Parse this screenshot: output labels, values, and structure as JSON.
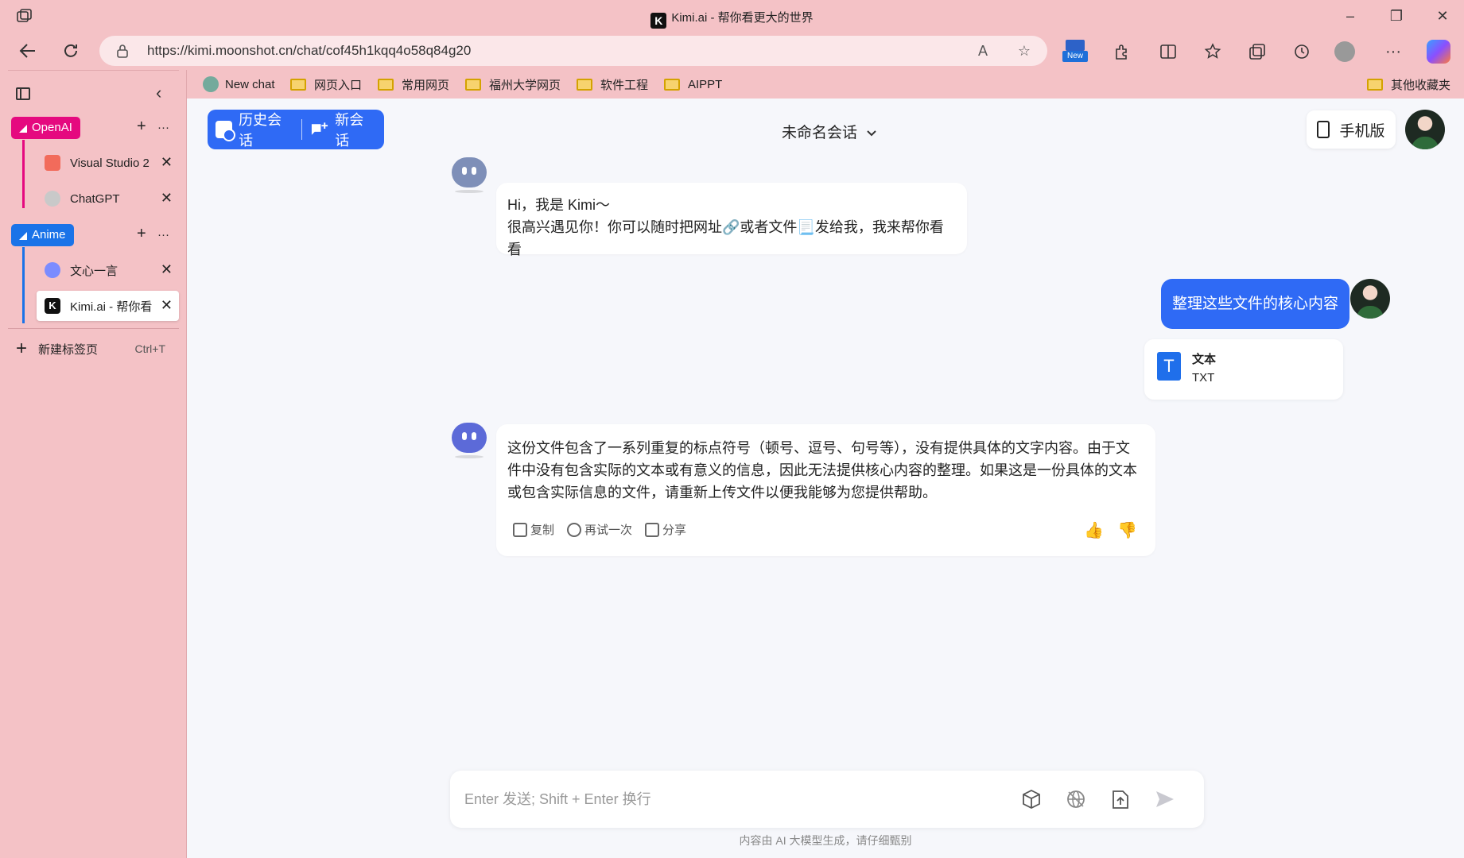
{
  "window": {
    "title": "Kimi.ai - 帮你看更大的世界",
    "controls": {
      "minimize": "–",
      "restore": "❐",
      "close": "✕"
    }
  },
  "addressbar": {
    "url": "https://kimi.moonshot.cn/chat/cof45h1kqq4o58q84g20",
    "read_aloud_icon": "A",
    "favorite_icon": "☆"
  },
  "toolbar": {
    "new_badge": "New",
    "more": "···"
  },
  "bookmarks": [
    {
      "label": "New chat",
      "icon": "chatgpt-logo"
    },
    {
      "label": "网页入口",
      "icon": "folder"
    },
    {
      "label": "常用网页",
      "icon": "folder"
    },
    {
      "label": "福州大学网页",
      "icon": "folder"
    },
    {
      "label": "软件工程",
      "icon": "folder"
    },
    {
      "label": "AIPPT",
      "icon": "folder"
    }
  ],
  "bookmarks_other": "其他收藏夹",
  "sidebar": {
    "groups": [
      {
        "name": "OpenAI",
        "color": "#e5097f",
        "tabs": [
          {
            "label": "Visual Studio 2",
            "fav_color": "#f26b5b"
          },
          {
            "label": "ChatGPT",
            "fav_color": "#c9c9c9"
          }
        ]
      },
      {
        "name": "Anime",
        "color": "#1a73e8",
        "tabs": [
          {
            "label": "文心一言",
            "fav_color": "#7b8cff"
          },
          {
            "label": "Kimi.ai - 帮你看",
            "fav_color": "#111111",
            "active": true
          }
        ]
      }
    ],
    "plus": "+",
    "more": "···",
    "close": "✕",
    "new_tab": {
      "label": "新建标签页",
      "shortcut": "Ctrl+T"
    }
  },
  "header": {
    "history_label": "历史会话",
    "new_chat_label": "新会话",
    "conversation_title": "未命名会话",
    "phone_label": "手机版"
  },
  "messages": {
    "greeting_line1": "Hi，我是 Kimi～",
    "greeting_line2": "很高兴遇见你！你可以随时把网址🔗或者文件📃发给我，我来帮你看看",
    "user_message": "整理这些文件的核心内容",
    "file": {
      "name": "文本",
      "type": "TXT",
      "icon_letter": "T"
    },
    "reply": "这份文件包含了一系列重复的标点符号（顿号、逗号、句号等），没有提供具体的文字内容。由于文件中没有包含实际的文本或有意义的信息，因此无法提供核心内容的整理。如果这是一份具体的文本或包含实际信息的文件，请重新上传文件以便我能够为您提供帮助。",
    "actions": {
      "copy": "复制",
      "retry": "再试一次",
      "share": "分享"
    },
    "thumb_up": "👍",
    "thumb_down": "👎"
  },
  "composer": {
    "placeholder": "Enter 发送; Shift + Enter 换行",
    "disclaimer": "内容由 AI 大模型生成，请仔细甄别"
  },
  "colors": {
    "chrome": "#f4c2c6",
    "accent": "#2f6af5",
    "page_bg": "#f6f7fb"
  }
}
